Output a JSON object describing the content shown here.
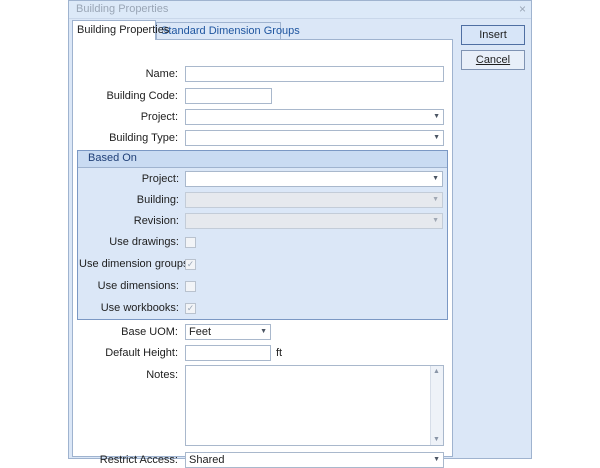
{
  "window": {
    "title": "Building Properties",
    "close_glyph": "×"
  },
  "tabs": [
    {
      "label": "Building Properties",
      "active": true
    },
    {
      "label": "Standard Dimension Groups",
      "active": false
    }
  ],
  "form": {
    "name_label": "Name:",
    "name_value": "",
    "building_code_label": "Building Code:",
    "building_code_value": "",
    "project_label": "Project:",
    "project_value": "",
    "building_type_label": "Building Type:",
    "building_type_value": ""
  },
  "based_on": {
    "title": "Based On",
    "project_label": "Project:",
    "project_value": "",
    "building_label": "Building:",
    "building_value": "",
    "revision_label": "Revision:",
    "revision_value": "",
    "use_drawings_label": "Use drawings:",
    "use_drawings_checked": false,
    "use_dimension_groups_label": "Use dimension groups:",
    "use_dimension_groups_checked": true,
    "use_dimensions_label": "Use dimensions:",
    "use_dimensions_checked": false,
    "use_workbooks_label": "Use workbooks:",
    "use_workbooks_checked": true
  },
  "settings": {
    "base_uom_label": "Base UOM:",
    "base_uom_value": "Feet",
    "default_height_label": "Default Height:",
    "default_height_value": "",
    "default_height_unit": "ft",
    "notes_label": "Notes:",
    "notes_value": "",
    "restrict_access_label": "Restrict Access:",
    "restrict_access_value": "Shared"
  },
  "buttons": {
    "insert_label": "Insert",
    "cancel_label": "Cancel"
  },
  "icons": {
    "dropdown": "chevron-down-icon",
    "checkmark": "✓"
  },
  "colors": {
    "window_bg": "#dbe7f7",
    "accent": "#1f56a0",
    "group_header": "#c9dbf2"
  }
}
